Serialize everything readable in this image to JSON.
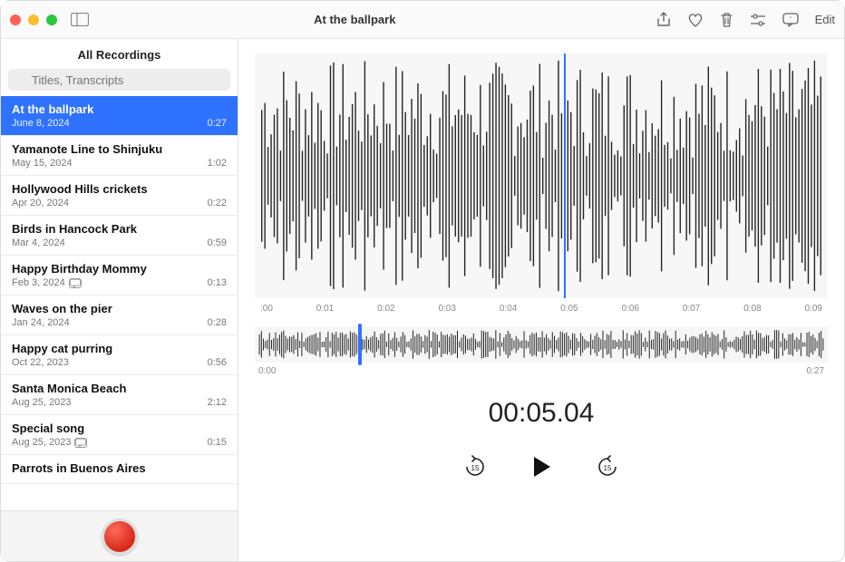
{
  "window": {
    "title": "At the ballpark",
    "edit_label": "Edit"
  },
  "sidebar": {
    "header": "All Recordings",
    "search_placeholder": "Titles, Transcripts",
    "items": [
      {
        "title": "At the ballpark",
        "date": "June 8, 2024",
        "duration": "0:27",
        "selected": true,
        "transcript": false
      },
      {
        "title": "Yamanote Line to Shinjuku",
        "date": "May 15, 2024",
        "duration": "1:02",
        "selected": false,
        "transcript": false
      },
      {
        "title": "Hollywood Hills crickets",
        "date": "Apr 20, 2024",
        "duration": "0:22",
        "selected": false,
        "transcript": false
      },
      {
        "title": "Birds in Hancock Park",
        "date": "Mar 4, 2024",
        "duration": "0:59",
        "selected": false,
        "transcript": false
      },
      {
        "title": "Happy Birthday Mommy",
        "date": "Feb 3, 2024",
        "duration": "0:13",
        "selected": false,
        "transcript": true
      },
      {
        "title": "Waves on the pier",
        "date": "Jan 24, 2024",
        "duration": "0:28",
        "selected": false,
        "transcript": false
      },
      {
        "title": "Happy cat purring",
        "date": "Oct 22, 2023",
        "duration": "0:56",
        "selected": false,
        "transcript": false
      },
      {
        "title": "Santa Monica Beach",
        "date": "Aug 25, 2023",
        "duration": "2:12",
        "selected": false,
        "transcript": false
      },
      {
        "title": "Special song",
        "date": "Aug 25, 2023",
        "duration": "0:15",
        "selected": false,
        "transcript": true
      },
      {
        "title": "Parrots in Buenos Aires",
        "date": "",
        "duration": "",
        "selected": false,
        "transcript": false
      }
    ]
  },
  "main": {
    "axis": [
      ":00",
      "0:01",
      "0:02",
      "0:03",
      "0:04",
      "0:05",
      "0:06",
      "0:07",
      "0:08",
      "0:09"
    ],
    "overview_start": "0:00",
    "overview_end": "0:27",
    "current_time": "00:05.04",
    "skip_seconds": "15"
  }
}
